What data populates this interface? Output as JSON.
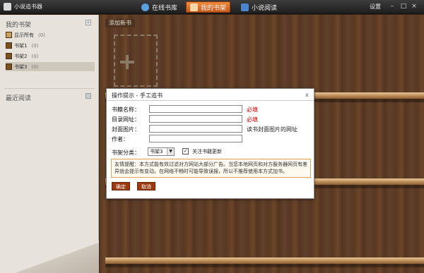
{
  "app": {
    "title": "小说追书器"
  },
  "nav": {
    "tabs": [
      {
        "label": "在线书库",
        "icon": "globe-icon",
        "active": false
      },
      {
        "label": "我的书架",
        "icon": "shelf-icon",
        "active": true
      },
      {
        "label": "小说阅读",
        "icon": "book-icon",
        "active": false
      }
    ],
    "settings": "设置",
    "window_buttons": {
      "minimize": "–",
      "maximize": "□",
      "close": "×"
    }
  },
  "sidebar": {
    "my_shelf_title": "我的书架",
    "add_button": "+",
    "items": [
      {
        "label": "显示所有",
        "count": "(0)"
      },
      {
        "label": "书架1",
        "count": "(0)"
      },
      {
        "label": "书架2",
        "count": "(0)"
      },
      {
        "label": "书架3",
        "count": "(0)"
      }
    ],
    "recent_title": "最近阅读"
  },
  "shelf": {
    "add_new_book": "添加新书"
  },
  "dialog": {
    "title": "操作提示 - 手工追书",
    "close": "x",
    "fields": [
      {
        "label": "书籍名称：",
        "value": "",
        "note": "必填"
      },
      {
        "label": "目录网址：",
        "value": "",
        "note": "必填"
      },
      {
        "label": "封面图片：",
        "value": "",
        "note": "读书封面图片的网址"
      },
      {
        "label": "作者：",
        "value": "",
        "note": ""
      }
    ],
    "category_label": "书架分类：",
    "category_value": "书架3",
    "follow_label": "关注书籍更新",
    "follow_checked": "✓",
    "notice": "友情提醒：本方式能有效过滤对方网站大部分广告。当您本地网页和对方服务器网页有差异就会提示有变动。在网络不畅时可能导致误报，所以不推荐使用本方式加书。",
    "confirm": "确定",
    "cancel": "取消"
  },
  "colors": {
    "accent": "#e0762a",
    "required": "#d40000",
    "button": "#9a3a0e"
  }
}
